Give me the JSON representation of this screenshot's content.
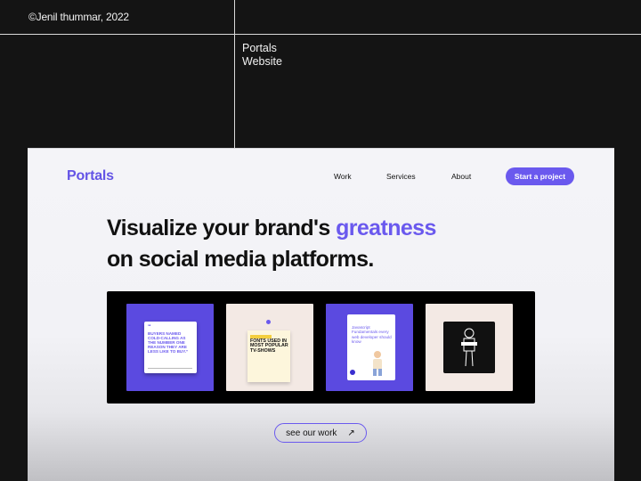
{
  "credit": "©Jenil thummar, 2022",
  "project": {
    "line1": "Portals",
    "line2": "Website"
  },
  "site": {
    "logo": "Portals",
    "nav": {
      "work": "Work",
      "services": "Services",
      "about": "About"
    },
    "cta_label": "Start a project",
    "headline": {
      "part1": "Visualize your brand's ",
      "highlight": "greatness",
      "line2": "on social media platforms."
    },
    "see_work_label": "see our work",
    "see_work_icon": "arrow-up-right-icon",
    "accent_color": "#6a59ee",
    "cards": [
      {
        "quote_mark": "“",
        "text": "BUYERS NAMED COLD-CALLING AS THE NUMBER ONE REASON THEY ARE LESS LIKE TO BUY.”"
      },
      {
        "tag": "",
        "text": "FONTS USED IN MOST POPULAR TV-SHOWS"
      },
      {
        "text": "Javascript Fundamentals every web developer should know"
      },
      {
        "text": ""
      }
    ]
  }
}
